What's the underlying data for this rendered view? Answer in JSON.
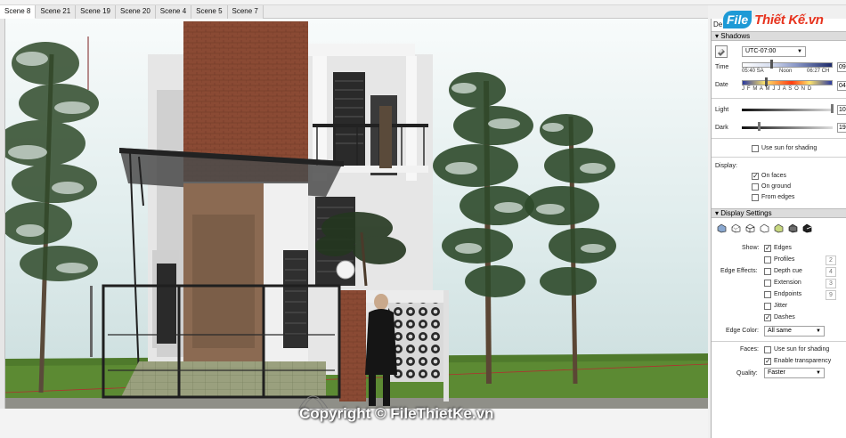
{
  "scene_tabs": [
    "Scene 8",
    "Scene 21",
    "Scene 19",
    "Scene 20",
    "Scene 4",
    "Scene 5",
    "Scene 7"
  ],
  "active_tab": 0,
  "watermark_bottom": "Copyright © FileThietKe.vn",
  "logo": {
    "file": "File",
    "rest": "Thiết Kế.vn"
  },
  "tray": {
    "title": "De",
    "shadows": {
      "header": "Shadows",
      "timezone": "UTC-07:00",
      "time_label": "Time",
      "time_ticks": [
        "05:40 SA",
        "Noon",
        "06:27 CH"
      ],
      "time_value": "09",
      "date_label": "Date",
      "months": "J F M A M J J A S O N D",
      "date_value": "04",
      "light_label": "Light",
      "light_value": "10",
      "dark_label": "Dark",
      "dark_value": "19",
      "use_sun": "Use sun for shading",
      "display_label": "Display:",
      "on_faces": "On faces",
      "on_ground": "On ground",
      "from_edges": "From edges"
    },
    "display_settings": {
      "header": "Display Settings",
      "show_label": "Show:",
      "edges": "Edges",
      "profiles": "Profiles",
      "profiles_val": "2",
      "edge_effects_label": "Edge Effects:",
      "depth_cue": "Depth cue",
      "depth_cue_val": "4",
      "extension": "Extension",
      "extension_val": "3",
      "endpoints": "Endpoints",
      "endpoints_val": "9",
      "jitter": "Jitter",
      "dashes": "Dashes",
      "edge_color_label": "Edge Color:",
      "edge_color": "All same",
      "faces_label": "Faces:",
      "use_sun_faces": "Use sun for shading",
      "enable_transparency": "Enable transparency",
      "quality_label": "Quality:",
      "quality": "Faster"
    }
  }
}
